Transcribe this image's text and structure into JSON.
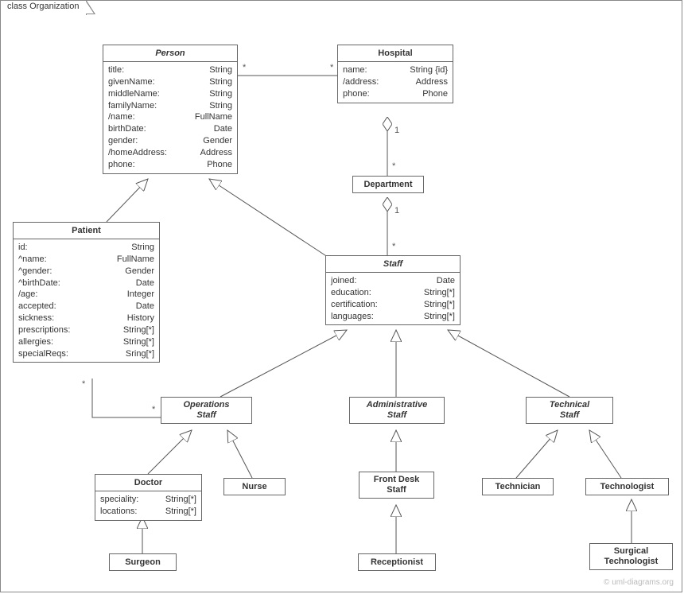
{
  "frame": {
    "title": "class Organization"
  },
  "classes": {
    "person": {
      "name": "Person",
      "attrs": [
        {
          "k": "title:",
          "t": "String"
        },
        {
          "k": "givenName:",
          "t": "String"
        },
        {
          "k": "middleName:",
          "t": "String"
        },
        {
          "k": "familyName:",
          "t": "String"
        },
        {
          "k": "/name:",
          "t": "FullName"
        },
        {
          "k": "birthDate:",
          "t": "Date"
        },
        {
          "k": "gender:",
          "t": "Gender"
        },
        {
          "k": "/homeAddress:",
          "t": "Address"
        },
        {
          "k": "phone:",
          "t": "Phone"
        }
      ]
    },
    "hospital": {
      "name": "Hospital",
      "attrs": [
        {
          "k": "name:",
          "t": "String {id}"
        },
        {
          "k": "/address:",
          "t": "Address"
        },
        {
          "k": "phone:",
          "t": "Phone"
        }
      ]
    },
    "department": {
      "name": "Department"
    },
    "patient": {
      "name": "Patient",
      "attrs": [
        {
          "k": "id:",
          "t": "String"
        },
        {
          "k": "^name:",
          "t": "FullName"
        },
        {
          "k": "^gender:",
          "t": "Gender"
        },
        {
          "k": "^birthDate:",
          "t": "Date"
        },
        {
          "k": "/age:",
          "t": "Integer"
        },
        {
          "k": "accepted:",
          "t": "Date"
        },
        {
          "k": "sickness:",
          "t": "History"
        },
        {
          "k": "prescriptions:",
          "t": "String[*]"
        },
        {
          "k": "allergies:",
          "t": "String[*]"
        },
        {
          "k": "specialReqs:",
          "t": "Sring[*]"
        }
      ]
    },
    "staff": {
      "name": "Staff",
      "attrs": [
        {
          "k": "joined:",
          "t": "Date"
        },
        {
          "k": "education:",
          "t": "String[*]"
        },
        {
          "k": "certification:",
          "t": "String[*]"
        },
        {
          "k": "languages:",
          "t": "String[*]"
        }
      ]
    },
    "opsStaff": {
      "name1": "Operations",
      "name2": "Staff"
    },
    "adminStaff": {
      "name1": "Administrative",
      "name2": "Staff"
    },
    "techStaff": {
      "name1": "Technical",
      "name2": "Staff"
    },
    "doctor": {
      "name": "Doctor",
      "attrs": [
        {
          "k": "speciality:",
          "t": "String[*]"
        },
        {
          "k": "locations:",
          "t": "String[*]"
        }
      ]
    },
    "nurse": {
      "name": "Nurse"
    },
    "frontDesk": {
      "name1": "Front Desk",
      "name2": "Staff"
    },
    "technician": {
      "name": "Technician"
    },
    "technologist": {
      "name": "Technologist"
    },
    "surgeon": {
      "name": "Surgeon"
    },
    "receptionist": {
      "name": "Receptionist"
    },
    "surgTech": {
      "name1": "Surgical",
      "name2": "Technologist"
    }
  },
  "labels": {
    "star": "*",
    "one": "1"
  },
  "watermark": "© uml-diagrams.org"
}
